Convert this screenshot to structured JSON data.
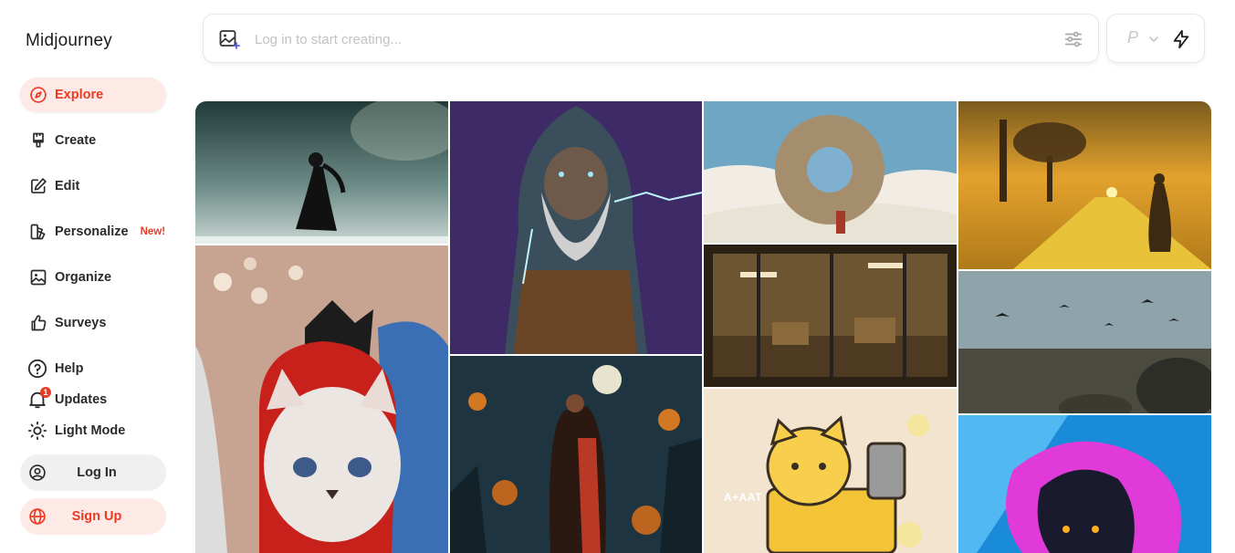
{
  "app": {
    "brand": "Midjourney"
  },
  "sidebar": {
    "items": [
      {
        "label": "Explore",
        "icon": "compass-icon",
        "active": true
      },
      {
        "label": "Create",
        "icon": "brush-icon"
      },
      {
        "label": "Edit",
        "icon": "edit-icon"
      },
      {
        "label": "Personalize",
        "icon": "personalize-icon",
        "badge": "New!"
      },
      {
        "label": "Organize",
        "icon": "image-icon"
      },
      {
        "label": "Surveys",
        "icon": "thumbs-up-icon"
      }
    ],
    "secondary": [
      {
        "label": "Help",
        "icon": "help-icon"
      },
      {
        "label": "Updates",
        "icon": "bell-icon",
        "count": "1"
      },
      {
        "label": "Light Mode",
        "icon": "sun-icon"
      }
    ],
    "login": "Log In",
    "signup": "Sign Up"
  },
  "search": {
    "placeholder": "Log in to start creating...",
    "value": ""
  },
  "speed": {
    "profile_letter": "P"
  },
  "gallery": {
    "tiles": [
      {
        "id": "dancer",
        "subject": "cloaked dancer on misty stage"
      },
      {
        "id": "wizard",
        "subject": "hooded bearded wizard with lightning"
      },
      {
        "id": "ring-ship",
        "subject": "circular stone portal above clouds"
      },
      {
        "id": "golden-road",
        "subject": "tree and cloaked figure on golden cracked road"
      },
      {
        "id": "cat",
        "subject": "white cat in red hood"
      },
      {
        "id": "office",
        "subject": "office interior at night"
      },
      {
        "id": "birds",
        "subject": "birds over dry cracked land"
      },
      {
        "id": "couple",
        "subject": "couple embracing under full moon amid fire"
      },
      {
        "id": "cartoon-cat",
        "subject": "cartoon yellow cat on tank",
        "caption": "A+AAT"
      },
      {
        "id": "neon",
        "subject": "anime figure with pink neon flames"
      }
    ]
  },
  "colors": {
    "accent": "#ea3a22",
    "accent_bg": "#fde9e6"
  }
}
